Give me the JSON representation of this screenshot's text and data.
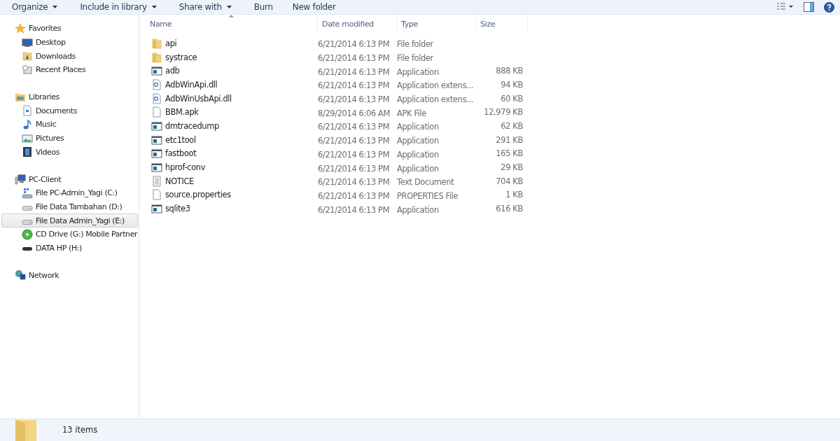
{
  "toolbar": {
    "buttons": [
      {
        "label": "Organize",
        "dropdown": true
      },
      {
        "label": "Include in library",
        "dropdown": true
      },
      {
        "label": "Share with",
        "dropdown": true
      },
      {
        "label": "Burn",
        "dropdown": false
      },
      {
        "label": "New folder",
        "dropdown": false
      }
    ]
  },
  "sidebar": {
    "groups": [
      {
        "label": "Favorites",
        "kind": "star",
        "children": [
          {
            "label": "Desktop",
            "kind": "desktop",
            "selected": false
          },
          {
            "label": "Downloads",
            "kind": "downloads",
            "selected": false
          },
          {
            "label": "Recent Places",
            "kind": "recent",
            "selected": false
          }
        ]
      },
      {
        "label": "Libraries",
        "kind": "library",
        "children": [
          {
            "label": "Documents",
            "kind": "document",
            "selected": false
          },
          {
            "label": "Music",
            "kind": "music",
            "selected": false
          },
          {
            "label": "Pictures",
            "kind": "pictures",
            "selected": false
          },
          {
            "label": "Videos",
            "kind": "videos",
            "selected": false
          }
        ]
      },
      {
        "label": "PC-Client",
        "kind": "computer",
        "children": [
          {
            "label": "File PC-Admin_Yagi (C:)",
            "kind": "systemdrive",
            "selected": false
          },
          {
            "label": "File Data Tambahan (D:)",
            "kind": "drive",
            "selected": false
          },
          {
            "label": "File Data Admin_Yagi (E:)",
            "kind": "drive",
            "selected": true
          },
          {
            "label": "CD Drive (G:) Mobile Partner",
            "kind": "cd",
            "selected": false
          },
          {
            "label": "DATA HP (H:)",
            "kind": "removable",
            "selected": false
          }
        ]
      },
      {
        "label": "Network",
        "kind": "network"
      }
    ]
  },
  "table": {
    "columns": [
      "Name",
      "Date modified",
      "Type",
      "Size"
    ],
    "rows": [
      {
        "kind": "folder",
        "name": "api",
        "date": "6/21/2014 6:13 PM",
        "type": "File folder"
      },
      {
        "kind": "folder",
        "name": "systrace",
        "date": "6/21/2014 6:13 PM",
        "type": "File folder"
      },
      {
        "kind": "app",
        "name": "adb",
        "date": "6/21/2014 6:13 PM",
        "type": "Application",
        "size": "888 KB"
      },
      {
        "kind": "dll",
        "name": "AdbWinApi.dll",
        "date": "6/21/2014 6:13 PM",
        "type": "Application extens...",
        "size": "94 KB"
      },
      {
        "kind": "dll",
        "name": "AdbWinUsbApi.dll",
        "date": "6/21/2014 6:13 PM",
        "type": "Application extens...",
        "size": "60 KB"
      },
      {
        "kind": "blank",
        "name": "BBM.apk",
        "date": "8/29/2014 6:06 AM",
        "type": "APK File",
        "size": "12,979 KB"
      },
      {
        "kind": "app",
        "name": "dmtracedump",
        "date": "6/21/2014 6:13 PM",
        "type": "Application",
        "size": "62 KB"
      },
      {
        "kind": "app",
        "name": "etc1tool",
        "date": "6/21/2014 6:13 PM",
        "type": "Application",
        "size": "291 KB"
      },
      {
        "kind": "app",
        "name": "fastboot",
        "date": "6/21/2014 6:13 PM",
        "type": "Application",
        "size": "165 KB"
      },
      {
        "kind": "app",
        "name": "hprof-conv",
        "date": "6/21/2014 6:13 PM",
        "type": "Application",
        "size": "29 KB"
      },
      {
        "kind": "text",
        "name": "NOTICE",
        "date": "6/21/2014 6:13 PM",
        "type": "Text Document",
        "size": "704 KB"
      },
      {
        "kind": "blank",
        "name": "source.properties",
        "date": "6/21/2014 6:13 PM",
        "type": "PROPERTIES File",
        "size": "1 KB"
      },
      {
        "kind": "app",
        "name": "sqlite3",
        "date": "6/21/2014 6:13 PM",
        "type": "Application",
        "size": "616 KB"
      }
    ]
  },
  "status_bar": {
    "count": "13 items"
  }
}
